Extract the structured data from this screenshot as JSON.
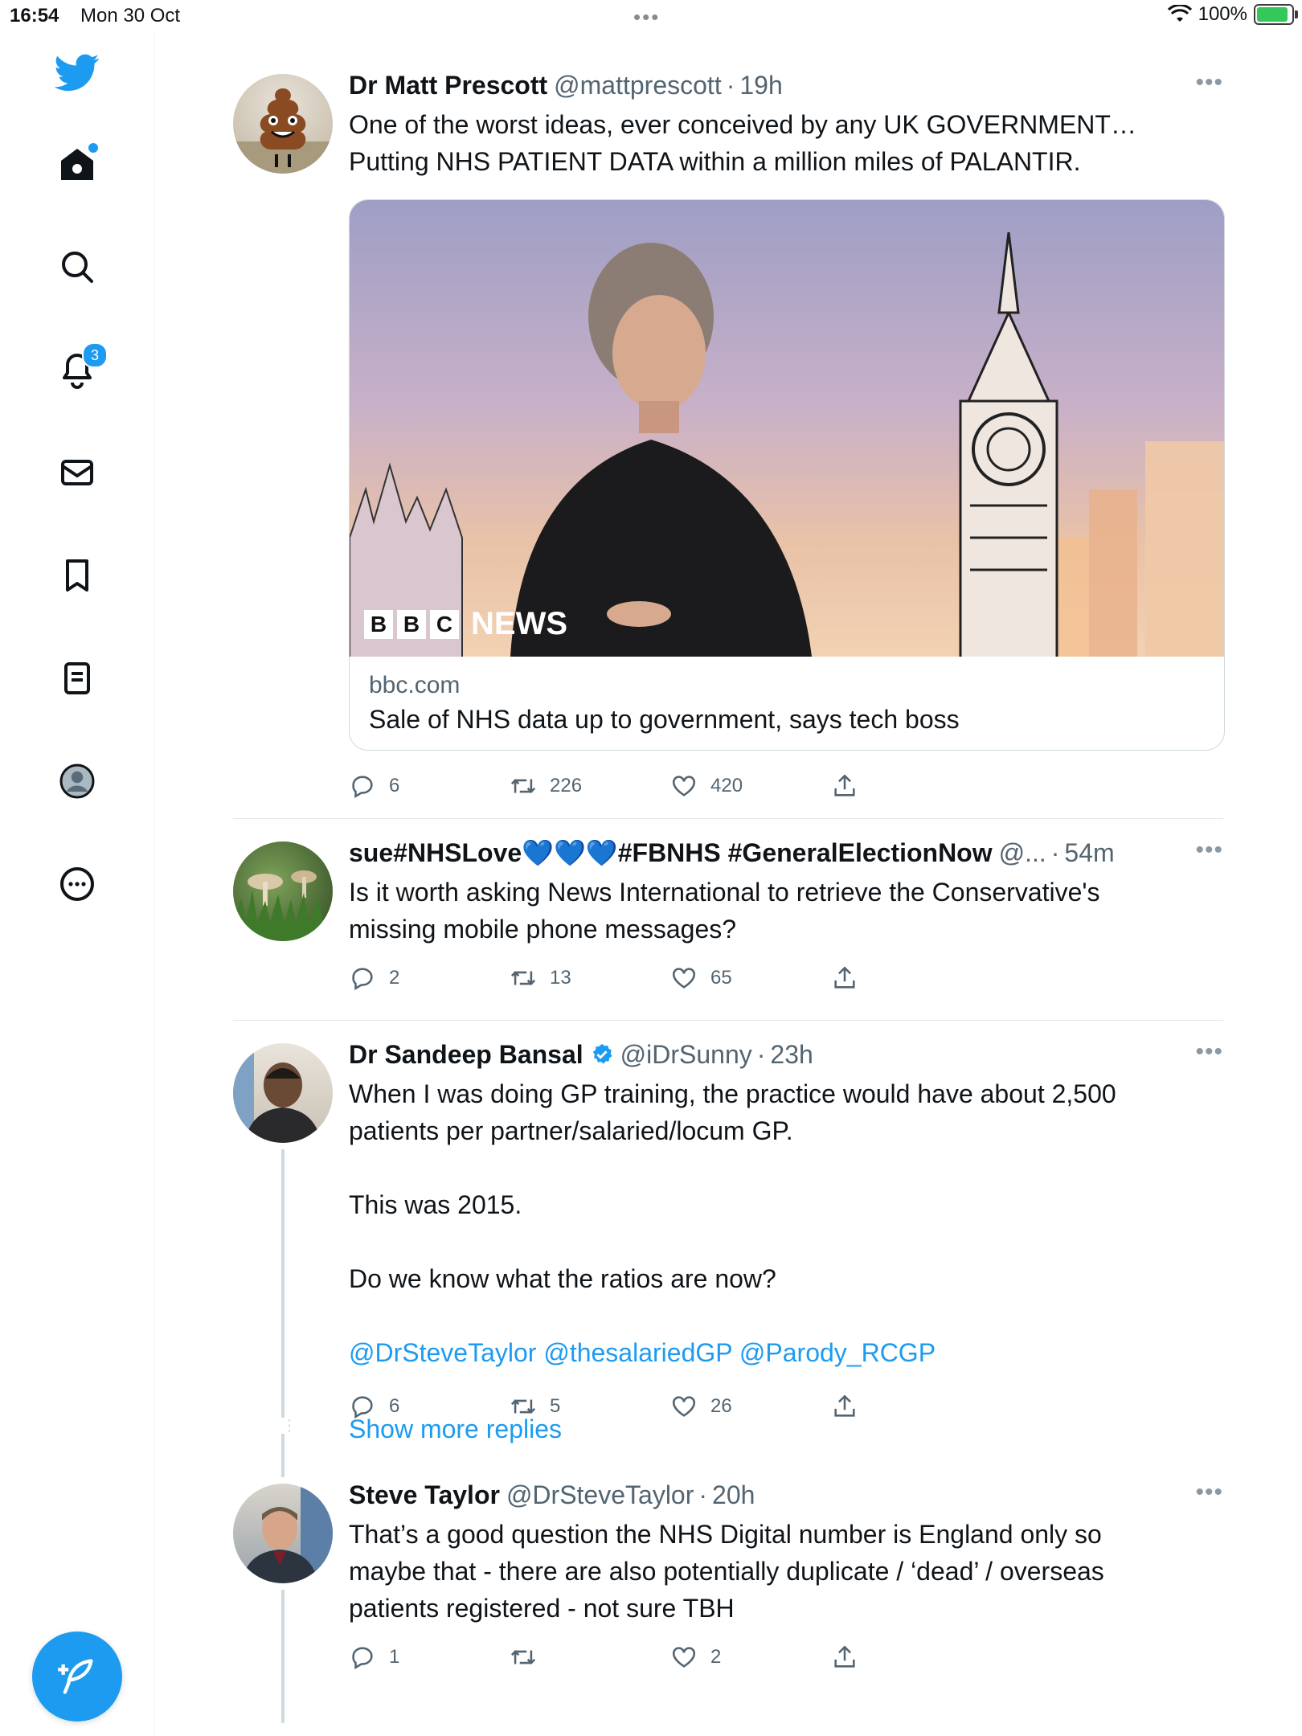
{
  "status": {
    "time": "16:54",
    "date": "Mon 30 Oct",
    "battery": "100%",
    "battery_level": 1.0
  },
  "sidebar": {
    "notifications_count": "3"
  },
  "tweets": [
    {
      "name": "Dr Matt Prescott",
      "handle": "@mattprescott",
      "time": "19h",
      "text": "One of the worst ideas, ever conceived by any UK GOVERNMENT…\nPutting NHS PATIENT DATA within a million miles of PALANTIR.",
      "card": {
        "domain": "bbc.com",
        "title": "Sale of NHS data up to government, says tech boss",
        "image_logo": "BBC NEWS",
        "logo_letters": [
          "B",
          "B",
          "C"
        ],
        "logo_word": "NEWS"
      },
      "replies": "6",
      "retweets": "226",
      "likes": "420"
    },
    {
      "name": "sue#NHSLove💙💙💙#FBNHS #GeneralElectionNow",
      "handle": "@...",
      "time": "54m",
      "text": "Is it worth asking News International to retrieve the Conservative's\nmissing mobile phone messages?",
      "replies": "2",
      "retweets": "13",
      "likes": "65"
    },
    {
      "name": "Dr Sandeep Bansal",
      "handle": "@iDrSunny",
      "time": "23h",
      "text": "When I was doing GP training, the practice would have about 2,500\npatients per partner/salaried/locum GP.\n\nThis was 2015.\n\nDo we know what the ratios are now?",
      "mentions": "@DrSteveTaylor @thesalariedGP @Parody_RCGP",
      "replies": "6",
      "retweets": "5",
      "likes": "26"
    },
    {
      "show_more": "Show more replies"
    },
    {
      "name": "Steve Taylor",
      "handle": "@DrSteveTaylor",
      "time": "20h",
      "text": "That’s a good question the NHS Digital number is England only so\nmaybe that - there are also potentially duplicate / ‘dead’ / overseas\npatients registered - not sure TBH",
      "replies": "1",
      "retweets": "",
      "likes": "2"
    }
  ],
  "colors": {
    "accent": "#1d9bf0",
    "text": "#0f1419",
    "secondary": "#536471",
    "border": "#e1e8ed"
  }
}
